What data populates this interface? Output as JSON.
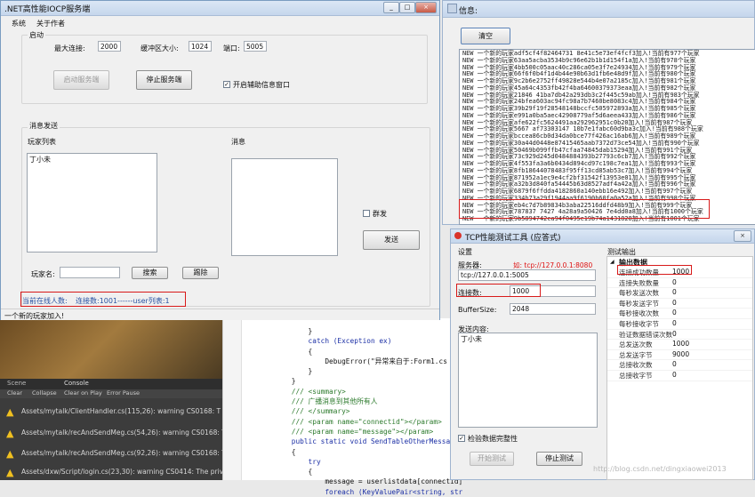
{
  "server_window": {
    "title": ".NET高性能IOCP服务端",
    "menu": [
      "系统",
      "关于作者"
    ],
    "startup_group": "启动",
    "max_conn_label": "最大连接:",
    "max_conn_value": "2000",
    "buffer_label": "缓冲区大小:",
    "buffer_value": "1024",
    "port_label": "端口:",
    "port_value": "5005",
    "start_btn": "启动服务端",
    "stop_btn": "停止服务端",
    "aux_check_label": "开启辅助信息窗口",
    "msg_group": "消息发送",
    "player_list_label": "玩家列表",
    "player_list_items": [
      "丁小未"
    ],
    "message_label": "消息",
    "broadcast_label": "群发",
    "send_btn": "发送",
    "player_name_label": "玩家名:",
    "search_btn": "搜索",
    "kick_btn": "踢除",
    "status_online": "当前在线人数:",
    "status_conn": "连接数:1001------user列表:1",
    "status_bar": "一个新的玩家加入!"
  },
  "info_window": {
    "title": "信息:",
    "clear_btn": "清空",
    "log_lines": [
      "NEW   一个新的玩家adf5cf4f82464731 8e41c5e73ef4fcf3加入!当前有977个玩家",
      "NEW   一个新的玩家63aa5acba3534b9c96e62b1b1d154f1a加入!当前有978个玩家",
      "NEW   一个新的玩家4bb500c05aac40c286ca05e3f7e24934加入!当前有979个玩家",
      "NEW   一个新的玩家66f6f0b4f1d4b44e90b63d1fb6e48d9f加入!当前有980个玩家",
      "NEW   一个新的玩家9c2b6e2752ff49828e544b4e07a2185c加入!当前有981个玩家",
      "NEW   一个新的玩家45a64c4353fb42f4ba64600379373eaa加入!当前有982个玩家",
      "NEW   一个新的玩家21846 41ba7db42a293db3c2f445c59ab加入!当前有983个玩家",
      "NEW   一个新的玩家24bfea603ac94fc98a7b7460be8083c4加入!当前有984个玩家",
      "NEW   一个新的玩家39b29f19f28548148bccfc505972893a加入!当前有985个玩家",
      "NEW   一个新的玩家e991a0ba5aec42908779af5d6aeea433加入!当前有986个玩家",
      "NEW   一个新的玩家afe622fc5624491aa292962951c0b20加入!当前有987个玩家",
      "NEW   一个新的玩家5667 af73303147 10b7e1fabc60d9ba3c加入!当前有988个玩家",
      "NEW   一个新的玩家bccea86cb0d34da0bce77f426ac16ab6加入!当前有989个玩家",
      "NEW   一个新的玩家30a44d0448e87415465aab7372d73ce54加入!当前有990个玩家",
      "NEW   一个新的玩家50469b099ffb47cfaa74845dab15294加入!当前有991个玩家",
      "NEW   一个新的玩家73c929d245d0484884393b27793c6cb7加入!当前有992个玩家",
      "NEW   一个新的玩家4f553fa3a6b0434d894cd97c198c7ea1加入!当前有993个玩家",
      "NEW   一个新的玩家8fb18644078483f95ff13cd85ab53c7加入!当前有994个玩家",
      "NEW   一个新的玩家871952a1ec9e4cf2bf31542f13953e01加入!当前有995个玩家",
      "NEW   一个新的玩家a32b3d840fa54445b63d8527adf4a42a加入!当前有996个玩家",
      "NEW   一个新的玩家6879f6ffdda4182860a140ebb16e492加入!当前有997个玩家",
      "NEW   一个新的玩家334b73a29f1944aa9f6190b60fa0a52a加入!当前有998个玩家",
      "NEW   一个新的玩家eb4c7d7b89834b3aba22516ddfd48b9加入!当前有999个玩家",
      "NEW   一个新的玩家787837 7427 4a28a9a50426 7e4dd0a8加入!当前有1000个玩家",
      "NEW   一个新的玩家9b5894742ca94f0495e19b74a1431828加入!当前有1001个玩家"
    ]
  },
  "tcp_window": {
    "title": "TCP性能测试工具 (应答式)",
    "settings_label": "设置",
    "server_label": "服务器:",
    "server_hint": "如: tcp://127.0.0.1:8080",
    "server_value": "tcp://127.0.0.1:5005",
    "conn_label": "连接数:",
    "conn_value": "1000",
    "buffer_label": "BufferSize:",
    "buffer_value": "2048",
    "send_content_label": "发送内容:",
    "send_content_value": "丁小未",
    "verify_label": "检验数据完整性",
    "start_btn": "开始测试",
    "stop_btn": "停止测试",
    "output_label": "测试输出",
    "output_group": "输出数据",
    "stats": [
      {
        "name": "连接成功数量",
        "value": "1000"
      },
      {
        "name": "连接失败数量",
        "value": "0"
      },
      {
        "name": "每秒发送次数",
        "value": "0"
      },
      {
        "name": "每秒发送字节",
        "value": "0"
      },
      {
        "name": "每秒接收次数",
        "value": "0"
      },
      {
        "name": "每秒接收字节",
        "value": "0"
      },
      {
        "name": "验证数据错误次数",
        "value": "0"
      },
      {
        "name": "总发送次数",
        "value": "1000"
      },
      {
        "name": "总发送字节",
        "value": "9000"
      },
      {
        "name": "总接收次数",
        "value": "0"
      },
      {
        "name": "总接收字节",
        "value": "0"
      }
    ],
    "watermark": "http://blog.csdn.net/dingxiaowei2013"
  },
  "unity": {
    "tab_scene": "Scene",
    "tab_console": "Console",
    "toolbar": [
      "Clear",
      "Collapse",
      "Clear on Play",
      "Error Pause"
    ],
    "warnings": [
      "Assets/mytalk/ClientHandler.cs(115,26): warning CS0168: T",
      "Assets/mytalk/recAndSendMeg.cs(54,26): warning CS0168: T",
      "Assets/mytalk/recAndSendMeg.cs(92,26): warning CS0168: T",
      "Assets/dxw/Script/login.cs(23,30): warning CS0414: The priv"
    ]
  },
  "code_lines": [
    "        }",
    "        catch (Exception ex)",
    "        {",
    "            DebugError(\"异常来自于:Form1.cs A",
    "        }",
    "    }",
    "    /// <summary>",
    "    /// 广播消息到其他所有人",
    "    /// </summary>",
    "    /// <param name=\"connectid\"></param>",
    "    /// <param name=\"message\"></param>",
    "    public static void SendTableOtherMessage(",
    "    {",
    "        try",
    "        {",
    "            message = userlistdata[connectid]",
    "            foreach (KeyValuePair<string, str"
  ]
}
